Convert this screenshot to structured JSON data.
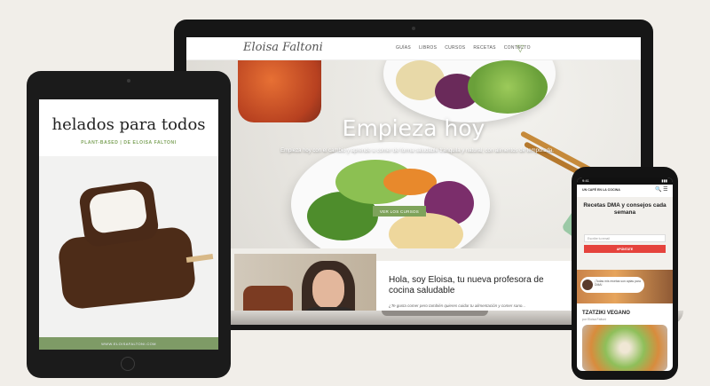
{
  "laptop": {
    "logo": "Eloisa Faltoni",
    "nav": [
      "GUÍAS",
      "LIBROS",
      "CURSOS",
      "RECETAS",
      "CONTACTO"
    ],
    "hero_title": "Empieza hoy",
    "hero_subtitle": "Empieza hoy con el cambio y aprende a comer de forma saludable tranquila y natural, con alimentos de temporada.",
    "hero_button": "VER LOS CURSOS",
    "about_title": "Hola, soy Eloisa, tu nueva profesora de cocina saludable",
    "about_text": "¿Te gusta comer pero también quieres cuidar tu alimentación y comer sano..."
  },
  "tablet": {
    "title": "helados para todos",
    "subtitle": "PLANT-BASED | DE ELOISA FALTONI",
    "footer": "WWW.ELOISAFALTONI.COM"
  },
  "phone": {
    "status_time": "9:41",
    "status_battery": "▮▮▮",
    "brand": "UN CAFÉ EN LA COCINA",
    "icons": "🔍 ☰",
    "hero_title": "Recetas DMA y consejos cada semana",
    "input_placeholder": "Escribe tu email",
    "subscribe_button": "APÚNTATE",
    "bubble_text": "¡Todas mis recetas son aptas para DMA!",
    "recipe_title": "TZATZIKI VEGANO",
    "recipe_author": "por Eloisa Faltoni"
  },
  "colors": {
    "accent_green": "#7ea35b",
    "subscribe_red": "#e5433d",
    "background": "#f1eee9"
  }
}
